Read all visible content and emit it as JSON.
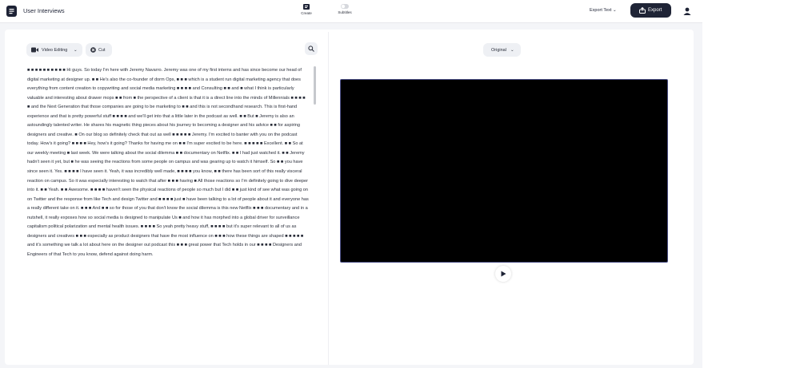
{
  "app": {
    "title": "User Interviews"
  },
  "header": {
    "modes": [
      {
        "label": "Create"
      },
      {
        "label": "Subtitles"
      }
    ],
    "export_text_label": "Export Text",
    "export_label": "Export"
  },
  "toolbar": {
    "video_editing_label": "Video Editing",
    "cut_label": "Cut"
  },
  "preview": {
    "original_label": "Original"
  },
  "transcript": {
    "text": "■ ■ ■ ■ ■ ■ ■ ■ ■ ■ Hi guys. So today I'm here with Jeremy Navarro. Jeremy was one of my first interns and has since become our head of digital marketing at designer up. ■ ■ He's also the co-founder of dorm Ops, ■ ■ ■ which is a student run digital marketing agency that does everything from content creation to copywriting and social media marketing ■ ■ ■ ■ and Consulting ■ ■ and ■ what I think is particularly valuable and interesting about drawer mops ■ ■ from ■ the perspective of a client is that it is a direct line into the minds of Millennials ■ ■ ■ ■ ■ and the Next Generation that those companies are going to be marketing to ■ ■ and this is not secondhand research. This is first-hand experience and that is pretty powerful stuff ■ ■ ■ ■ and we'll get into that a little later in the podcast as well. ■ ■ But ■ Jeremy is also an astoundingly talented writer. He shares his magnetic thing pieces about his journey to becoming a designer and his advice ■ ■ for aspiring designers and creative. ■ On our blog so definitely check that out as well ■ ■ ■ ■ ■ Jeremy. I'm excited to banter with you on the podcast today. How's it going? ■ ■ ■ ■ Hey, how's it going? Thanks for having me on ■ ■ I'm super excited to be here. ■ ■ ■ ■ ■ Excellent. ■ ■ So at our weekly meeting ■ last week. We were talking about the social dilemma ■ ■ documentary on Netflix. ■ ■ I had just watched it. ■ ■ Jeremy hadn't seen it yet, but ■ he was seeing the reactions from some people on campus and was gearing up to watch it himself. So ■ ■ you have since seen it. Yes. ■ ■ ■ ■ I have seen it. Yeah, it was incredibly well made, ■ ■ ■ ■ you know, ■ ■ there has been sort of this really visceral reaction on campus. So it was especially interesting to watch that after ■ ■ ■ having ■ All those reactions so I'm definitely going to dive deeper into it. ■ ■ Yeah. ■ ■ Awesome. ■ ■ ■ ■ haven't seen the physical reactions of people so much but I did ■ ■ just kind of see what was going on on Twitter and the response from like Tech and design Twitter and ■ ■ ■ ■ just ■ have been talking to a lot of people about it and everyone has a really different take on it. ■ ■ ■ And ■ ■ so for those of you that don't know the social dilemma is this new Netflix ■ ■ ■ documentary and in a nutshell, it really exposes how so social media is designed to manipulate Us ■ and how it has morphed into a global driver for surveillance capitalism political polarization and mental health issues. ■ ■ ■ ■ So yeah pretty heavy stuff, ■ ■ ■ ■ but it's super relevant to all of us as designers and creatives ■ ■ ■ especially as product designers that have the most influence on ■ ■ ■ how these things are shaped ■ ■ ■ ■ ■ and it's something we talk a lot about here on the designer out podcast this ■ ■ ■ great power that Tech holds in our ■ ■ ■ ■ Designers and Engineers of that Tech to you know, defend against doing harm."
  },
  "colors": {
    "accent": "#1f2436",
    "video_border": "#4b4f86",
    "background": "#f4f5f8"
  },
  "icons": {
    "app": "app-logo-icon",
    "create": "create-icon",
    "subtitles": "toggle-icon",
    "export": "export-icon",
    "user": "user-icon",
    "video": "camera-icon",
    "cut": "cut-icon",
    "search": "search-icon",
    "play": "play-icon"
  }
}
